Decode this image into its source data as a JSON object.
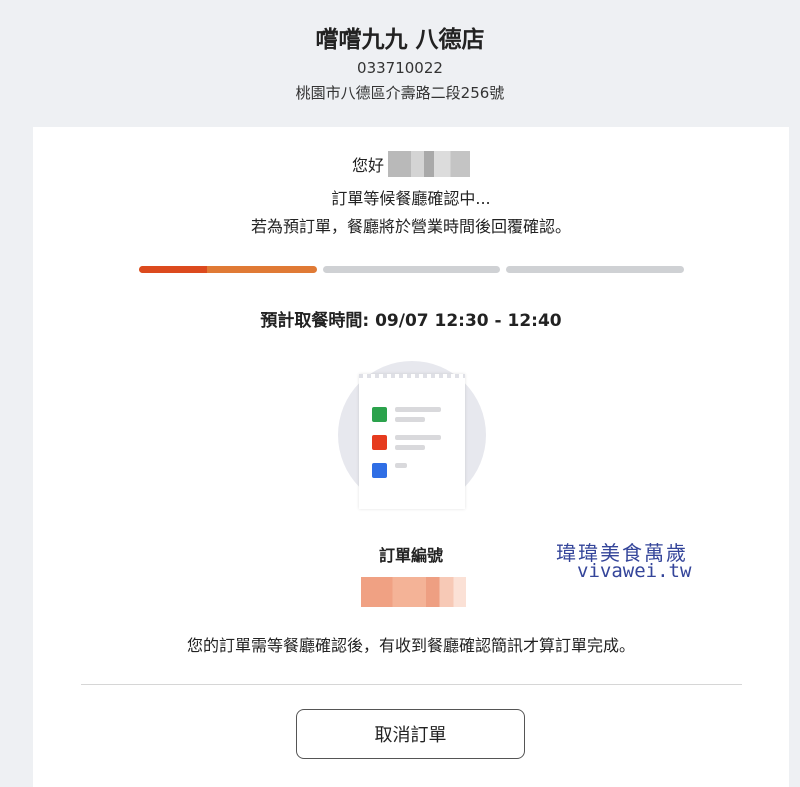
{
  "store": {
    "name": "嚐嚐九九 八德店",
    "phone": "033710022",
    "address": "桃園市八德區介壽路二段256號"
  },
  "status": {
    "greeting": "您好",
    "message_line1": "訂單等候餐廳確認中...",
    "message_line2": "若為預訂單，餐廳將於營業時間後回覆確認。",
    "progress": {
      "steps_total": 3,
      "current_step": 1,
      "current_step_fraction": 0.38
    }
  },
  "pickup": {
    "text": "預計取餐時間: 09/07 12:30 - 12:40"
  },
  "order": {
    "number_label": "訂單編號"
  },
  "notice": "您的訂單需等餐廳確認後，有收到餐廳確認簡訊才算訂單完成。",
  "actions": {
    "cancel_label": "取消訂單"
  },
  "watermark": {
    "title": "瑋瑋美食萬歲",
    "url": "vivawei.tw"
  },
  "colors": {
    "progress_active": "#dc4a1e",
    "progress_active_light": "#e07a35",
    "progress_inactive": "#cfd1d4",
    "watermark": "#34459a",
    "check_green": "#2ba24c",
    "check_red": "#e63b1e",
    "check_blue": "#2f6ee5"
  }
}
